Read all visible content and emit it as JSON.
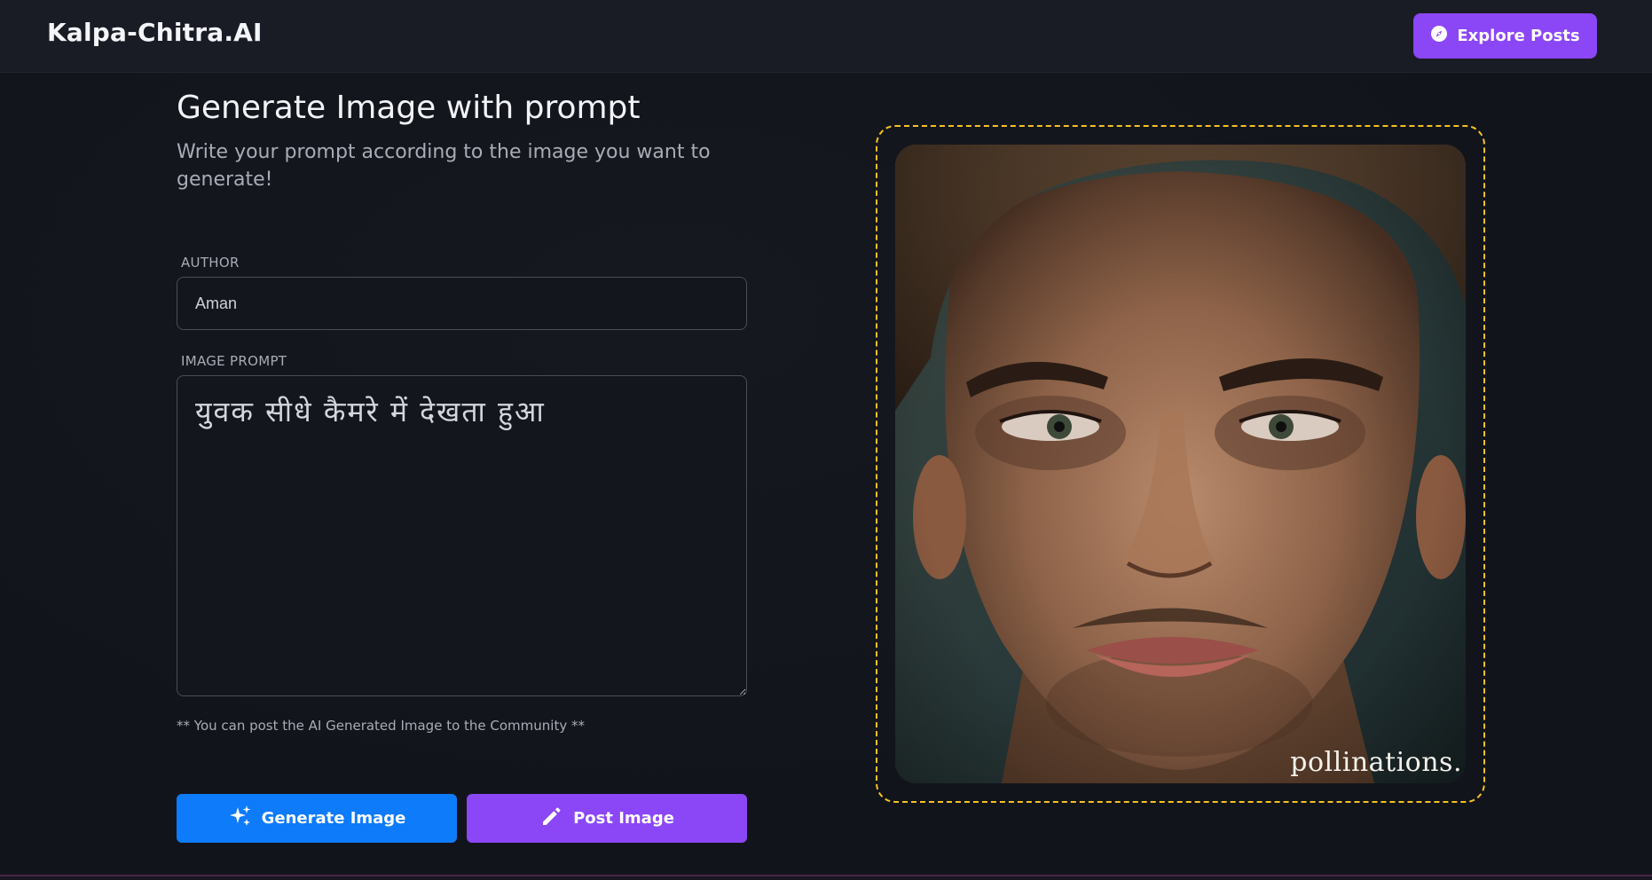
{
  "header": {
    "brand": "Kalpa-Chitra.AI",
    "explore_label": "Explore Posts",
    "explore_icon": "compass-icon"
  },
  "form": {
    "title": "Generate Image with prompt",
    "subtitle": "Write your prompt according to the image you want to generate!",
    "author_label": "AUTHOR",
    "author_value": "Aman",
    "prompt_label": "IMAGE PROMPT",
    "prompt_value": "युवक सीधे कैमरे में देखता हुआ",
    "note": "** You can post the AI Generated Image to the Community **",
    "generate_label": "Generate Image",
    "generate_icon": "sparkles-icon",
    "post_label": "Post Image",
    "post_icon": "pencil-icon"
  },
  "preview": {
    "watermark": "pollinations.",
    "frame_color": "#f5c220"
  },
  "colors": {
    "accent_purple": "#8b46f5",
    "accent_blue": "#0d7bfa",
    "background": "#13151c"
  }
}
